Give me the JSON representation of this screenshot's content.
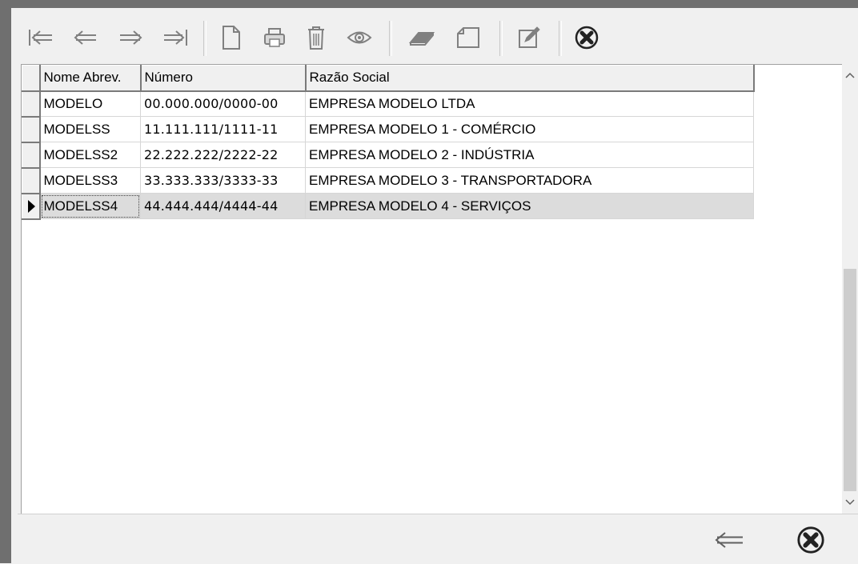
{
  "toolbar": {
    "buttons": [
      {
        "name": "first-record-icon"
      },
      {
        "name": "prior-record-icon"
      },
      {
        "name": "next-record-icon"
      },
      {
        "name": "last-record-icon"
      },
      {
        "name": "new-document-icon"
      },
      {
        "name": "print-icon"
      },
      {
        "name": "delete-trash-icon"
      },
      {
        "name": "view-eye-icon"
      },
      {
        "name": "eraser-icon"
      },
      {
        "name": "cancel-edit-icon"
      },
      {
        "name": "edit-icon"
      },
      {
        "name": "close-icon"
      }
    ]
  },
  "grid": {
    "columns": [
      "Nome Abrev.",
      "Número",
      "Razão Social"
    ],
    "rows": [
      {
        "nome": "MODELO",
        "numero": "00.000.000/0000-00",
        "razao": "EMPRESA MODELO LTDA"
      },
      {
        "nome": "MODELSS",
        "numero": "11.111.111/1111-11",
        "razao": "EMPRESA MODELO 1 - COMÉRCIO"
      },
      {
        "nome": "MODELSS2",
        "numero": "22.222.222/2222-22",
        "razao": "EMPRESA MODELO 2 - INDÚSTRIA"
      },
      {
        "nome": "MODELSS3",
        "numero": "33.333.333/3333-33",
        "razao": "EMPRESA MODELO 3 - TRANSPORTADORA"
      },
      {
        "nome": "MODELSS4",
        "numero": "44.444.444/4444-44",
        "razao": "EMPRESA MODELO 4 - SERVIÇOS"
      }
    ],
    "selected_row": 4
  },
  "scrollbar": {
    "up_icon": "chevron-up-icon",
    "down_icon": "chevron-down-icon"
  },
  "bottom": {
    "buttons": [
      {
        "name": "back-arrow-icon"
      },
      {
        "name": "close-icon"
      }
    ]
  }
}
